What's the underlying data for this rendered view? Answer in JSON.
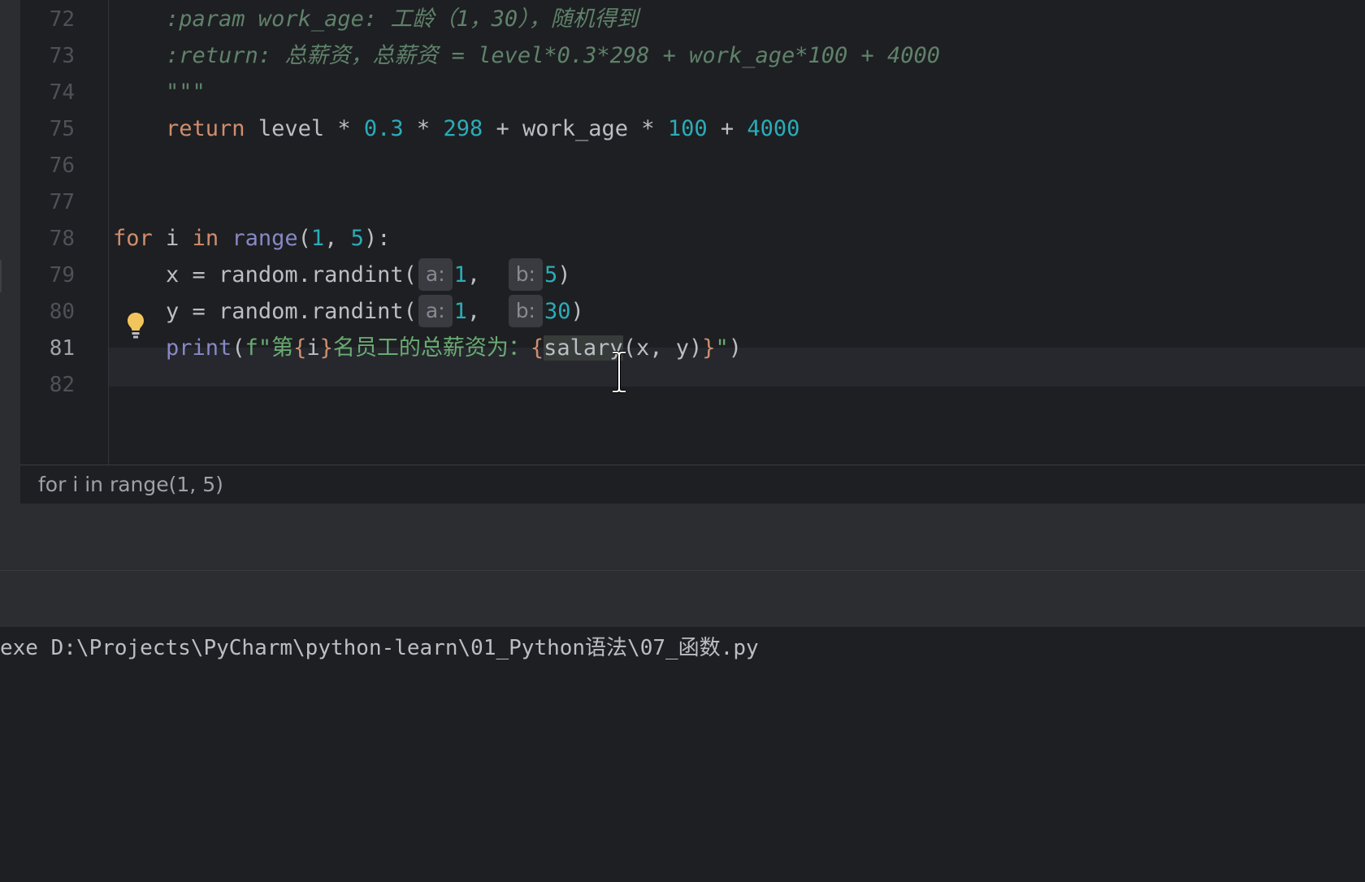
{
  "editor": {
    "line_numbers": [
      "72",
      "73",
      "74",
      "75",
      "76",
      "77",
      "78",
      "79",
      "80",
      "81",
      "82"
    ],
    "current_line": "81",
    "lines": {
      "l72": {
        "text": "    :param work_age: 工龄（1，30），随机得到"
      },
      "l73": {
        "text": "    :return: 总薪资，总薪资 = level*0.3*298 + work_age*100 + 4000"
      },
      "l74": {
        "text": "    \"\"\""
      },
      "l75": {
        "indent": "    ",
        "kw_return": "return",
        "t1": " level * ",
        "n1": "0.3",
        "t2": " * ",
        "n2": "298",
        "t3": " + work_age * ",
        "n3": "100",
        "t4": " + ",
        "n4": "4000"
      },
      "l78": {
        "kw_for": "for",
        "t1": " i ",
        "kw_in": "in",
        "sp": " ",
        "fn_range": "range",
        "p1": "(",
        "n1": "1",
        "c1": ", ",
        "n2": "5",
        "p2": "):"
      },
      "l79": {
        "indent": "    ",
        "t1": "x = random.randint(",
        "hint_a": "a:",
        "n1": "1",
        "c1": ",  ",
        "hint_b": "b:",
        "n2": "5",
        "p2": ")"
      },
      "l80": {
        "indent": "    ",
        "t1": "y = random.randint(",
        "hint_a": "a:",
        "n1": "1",
        "c1": ",  ",
        "hint_b": "b:",
        "n2": "30",
        "p2": ")"
      },
      "l81": {
        "indent": "    ",
        "fn_print": "print",
        "p1": "(",
        "fpre": "f\"第",
        "b1": "{",
        "var_i": "i",
        "b2": "}",
        "s1": "名员工的总薪资为：",
        "b3": "{",
        "call": "salary",
        "args": "(x, y)",
        "b4": "}",
        "s2": "\"",
        "p2": ")"
      }
    }
  },
  "breadcrumb": {
    "text": "for i in range(1, 5)"
  },
  "console": {
    "line": "exe D:\\Projects\\PyCharm\\python-learn\\01_Python语法\\07_函数.py"
  },
  "colors": {
    "background": "#1e1f22",
    "keyword": "#cf8e6d",
    "number": "#2aacb8",
    "builtin": "#8888c6",
    "string": "#6aab73",
    "docstring": "#5f826b",
    "lightbulb": "#f2c55c"
  },
  "icons": {
    "gutter_intention": "lightbulb-icon",
    "mouse_cursor": "text-cursor-icon"
  }
}
